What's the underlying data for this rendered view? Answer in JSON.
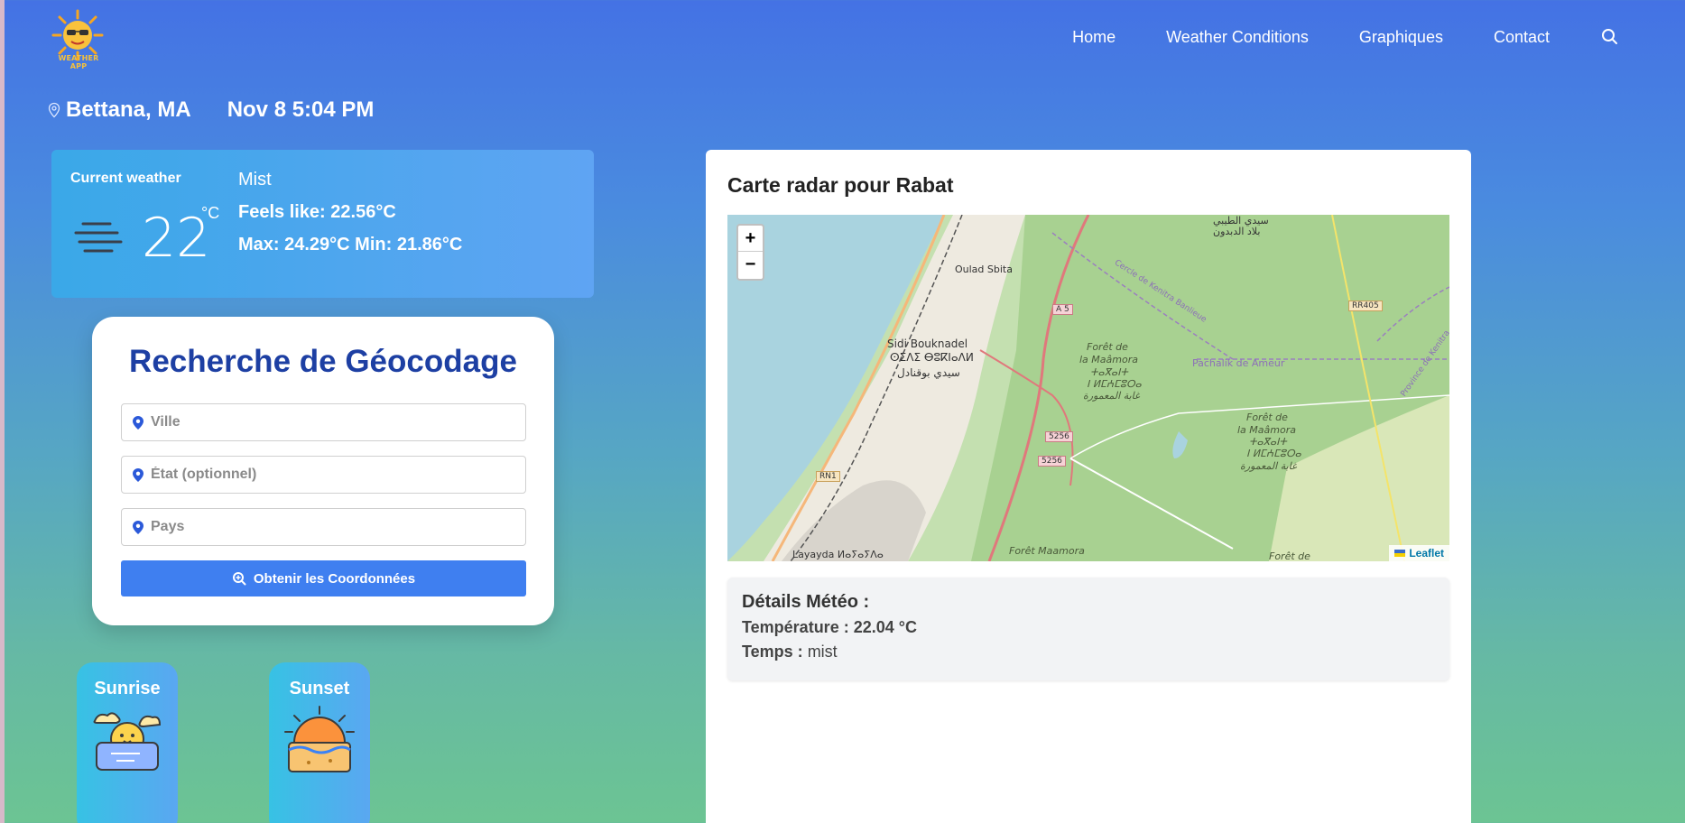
{
  "app": {
    "logo_text": "WEATHER APP"
  },
  "nav": {
    "items": [
      "Home",
      "Weather Conditions",
      "Graphiques",
      "Contact"
    ]
  },
  "location": {
    "city": "Bettana, MA",
    "datetime": "Nov 8 5:04 PM"
  },
  "current": {
    "label": "Current weather",
    "temp": "22",
    "unit": "°C",
    "condition": "Mist",
    "feels_like": "Feels like: 22.56°C",
    "max_min": "Max: 24.29°C  Min: 21.86°C"
  },
  "geocode": {
    "title": "Recherche de Géocodage",
    "city_placeholder": "Ville",
    "state_placeholder": "État (optionnel)",
    "country_placeholder": "Pays",
    "button": "Obtenir les Coordonnées"
  },
  "sun": {
    "sunrise_label": "Sunrise",
    "sunset_label": "Sunset"
  },
  "radar": {
    "title": "Carte radar pour Rabat",
    "zoom_in": "+",
    "zoom_out": "−",
    "attribution": "Leaflet",
    "labels": {
      "sidi_top": "سيدي الطيبي",
      "blad": "بلاد الدبدون",
      "oulad": "Oulad Sbita",
      "sidi_name": "Sidi Bouknadel",
      "sidi_tif": "ⵙⵉⴷⵉ ⴱⵓⴽⵏⴰⴷⵍ",
      "sidi_ar": "سيدي بوقنادل",
      "foret1": "Forêt de",
      "foret1b": "la Maâmora",
      "foret1c": "ⵜⴰⴳⴰⵏⵜ",
      "foret1d": "ⵏ ⵍⵎⵄⵎⵓⵔⴰ",
      "foret1e": "غابة المعمورة",
      "pachalik": "Pachalik de Ameur",
      "cercle": "Cercle de Kenitra Banlieue",
      "province": "Province de Kenitra",
      "layayda": "Layayda ⵍⴰⵢⴰⵢⴷⴰ",
      "foret_m": "Forêt Maamora",
      "foret_de": "Forêt de",
      "a5": "A 5",
      "rr405": "RR405",
      "rn1": "RN1",
      "r5256a": "5256",
      "r5256b": "5256"
    }
  },
  "details": {
    "heading": "Détails Météo :",
    "temperature_label": "Température : ",
    "temperature_value": "22.04 °C",
    "weather_label": "Temps : ",
    "weather_value": "mist"
  }
}
